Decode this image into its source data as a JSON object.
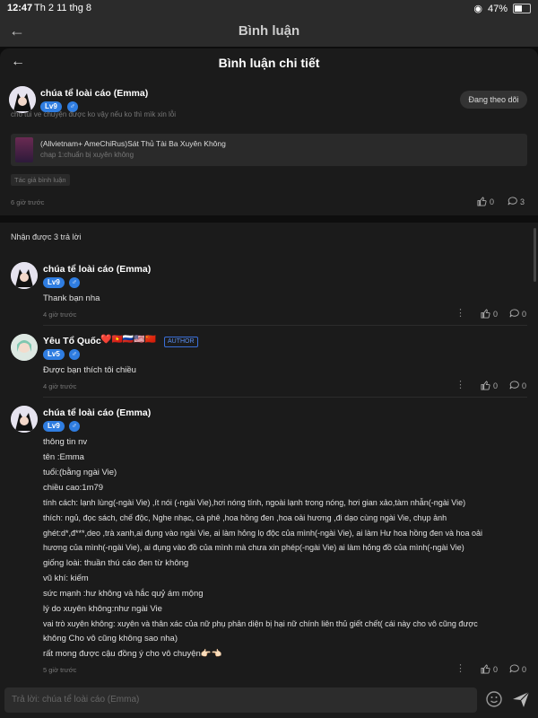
{
  "status": {
    "time": "12:47",
    "date": "Th 2 11 thg 8",
    "battery": "47%",
    "battery_level": 0.47
  },
  "topbar": {
    "title": "Bình luận"
  },
  "sheet": {
    "title": "Bình luận chi tiết"
  },
  "main_comment": {
    "user": "chúa tể loài cáo (Emma)",
    "level": "Lv9",
    "follow_label": "Đang theo dõi",
    "cut_text": "cho tui ve chuyện được ko vậy nếu ko thì mìk xin lỗi",
    "book_title": "(Allvietnam+ AmeChiRus)Sát Thủ Tài Ba Xuyên Không",
    "book_chapter": "chap 1:chuẩn bị xuyên không",
    "author_tag": "Tác giả bình luận",
    "time": "6 giờ trước",
    "likes": "0",
    "comments": "3"
  },
  "replies_header": "Nhận được 3 trả lời",
  "replies": [
    {
      "user": "chúa tể loài cáo (Emma)",
      "level": "Lv9",
      "text": "Thank bạn nha",
      "time": "4 giờ trước",
      "likes": "0",
      "comments": "0"
    },
    {
      "user": "Yêu Tổ Quốc",
      "level": "Lv5",
      "flags": "❤️🇻🇳🇷🇺🇺🇸🇨🇳",
      "badge": "AUTHOR",
      "text": "Được bạn thích tôi chiều",
      "time": "4 giờ trước",
      "likes": "0",
      "comments": "0"
    },
    {
      "user": "chúa tể loài cáo (Emma)",
      "level": "Lv9",
      "lines": [
        "thông tin nv",
        "tên :Emma",
        "tuổi:(bằng ngài Vie)",
        "chiều cao:1m79",
        "tính cách: lạnh lùng(-ngài Vie) ,ít nói (-ngài Vie),hơi nóng tính, ngoài lạnh trong nóng, hơi gian xảo,tàm nhẫn(-ngài Vie)",
        "thích: ngủ, đọc sách, chế độc, Nghe nhạc, cà phê ,hoa hồng đen ,hoa oải hương ,đi dạo cùng ngài Vie, chụp ảnh",
        "ghét:d*,đ***,deo ,trà xanh,ai đụng vào ngài Vie, ai làm hỏng lọ độc của mình(-ngài Vie), ai làm Hư hoa hồng đen và hoa oải",
        "hương của mình(-ngài Vie), ai đụng vào đồ của mình mà chưa xin phép(-ngài Vie) ai làm hỏng đồ của mình(-ngài Vie)",
        "giống loài: thuần thú cáo đen từ không",
        "vũ khí: kiếm",
        "sức mạnh :hư không và hắc quỷ ám mộng",
        "lý do xuyên không:như ngài Vie",
        "vai trò xuyên không: xuyên và thân xác của nữ phụ phản diện bị hại nữ chính liên thủ giết chết( cái này cho vô cũng được",
        "không Cho vô cũng không sao nha)",
        "rất mong được cậu đồng ý cho vô chuyện👉🏻👈🏻"
      ],
      "time": "5 giờ trước",
      "likes": "0",
      "comments": "0"
    }
  ],
  "input": {
    "placeholder": "Trả lời: chúa tể loài cáo (Emma)"
  },
  "colors": {
    "accent": "#2f7de1",
    "bg": "#1b1b1b",
    "page": "#0d0d0d"
  }
}
